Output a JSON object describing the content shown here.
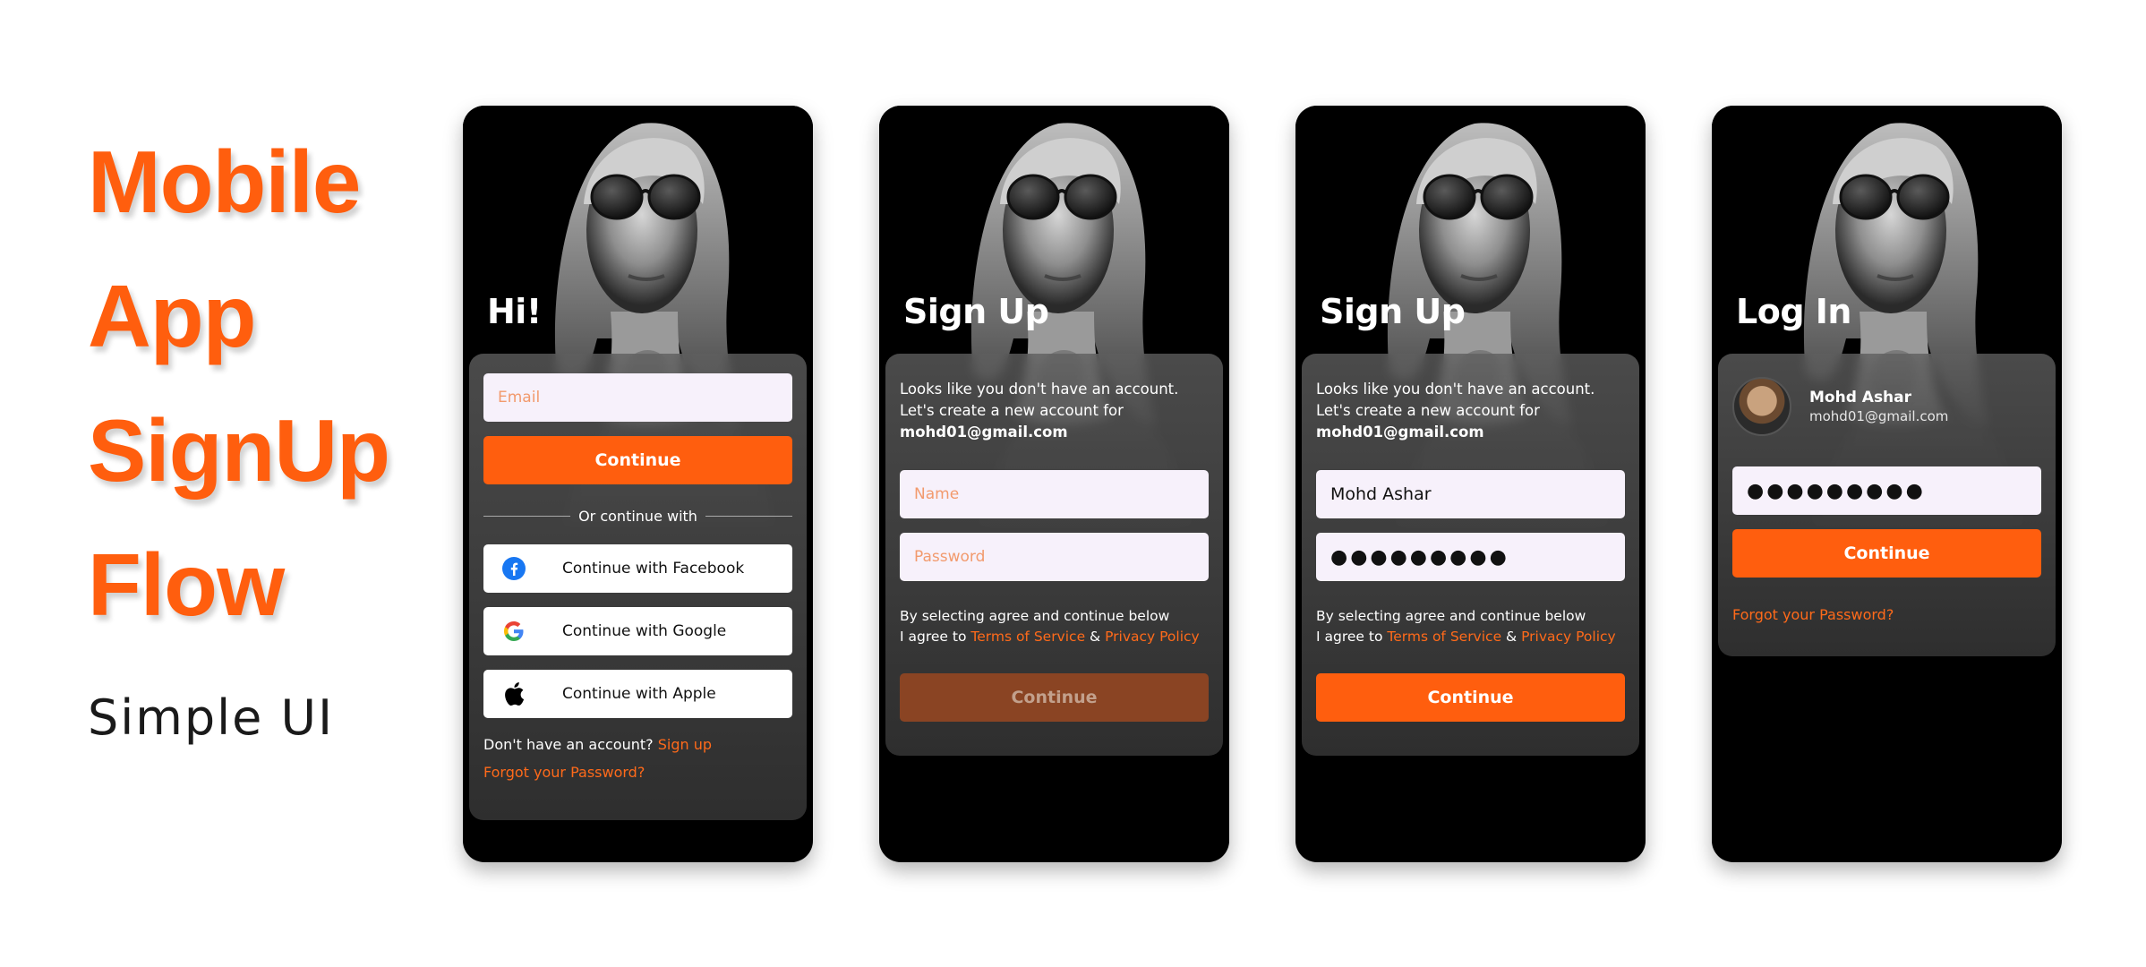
{
  "hero": {
    "title_lines": [
      "Mobile",
      "App",
      "SignUp",
      "Flow"
    ],
    "subtitle": "Simple UI"
  },
  "colors": {
    "accent": "#ff5e0e",
    "accent_disabled": "#8a4423",
    "field_bg": "#f7f1fb",
    "phone_bg": "#000000"
  },
  "screens": [
    {
      "title": "Hi!",
      "email_placeholder": "Email",
      "continue_label": "Continue",
      "divider_text": "Or continue with",
      "social": [
        {
          "icon": "facebook-icon",
          "label": "Continue with Facebook"
        },
        {
          "icon": "google-icon",
          "label": "Continue with Google"
        },
        {
          "icon": "apple-icon",
          "label": "Continue with Apple"
        }
      ],
      "no_account_text": "Don't have an account?",
      "signup_link": "Sign up",
      "forgot_link": "Forgot your Password?"
    },
    {
      "title": "Sign Up",
      "message_line1": "Looks like you don't have an account.",
      "message_line2": "Let's create a new account for",
      "email": "mohd01@gmail.com",
      "name_placeholder": "Name",
      "password_placeholder": "Password",
      "legal_line1": "By selecting agree and continue below",
      "legal_prefix": "I agree to",
      "terms_link": "Terms of Service",
      "amp": "&",
      "privacy_link": "Privacy Policy",
      "continue_label": "Continue"
    },
    {
      "title": "Sign Up",
      "message_line1": "Looks like you don't have an account.",
      "message_line2": "Let's create a new account for",
      "email": "mohd01@gmail.com",
      "name_value": "Mohd Ashar",
      "password_value": "●●●●●●●●●",
      "legal_line1": "By selecting agree and continue below",
      "legal_prefix": "I agree to",
      "terms_link": "Terms of Service",
      "amp": "&",
      "privacy_link": "Privacy Policy",
      "continue_label": "Continue"
    },
    {
      "title": "Log In",
      "user_name": "Mohd Ashar",
      "user_email": "mohd01@gmail.com",
      "password_value": "●●●●●●●●●",
      "continue_label": "Continue",
      "forgot_link": "Forgot your Password?"
    }
  ]
}
